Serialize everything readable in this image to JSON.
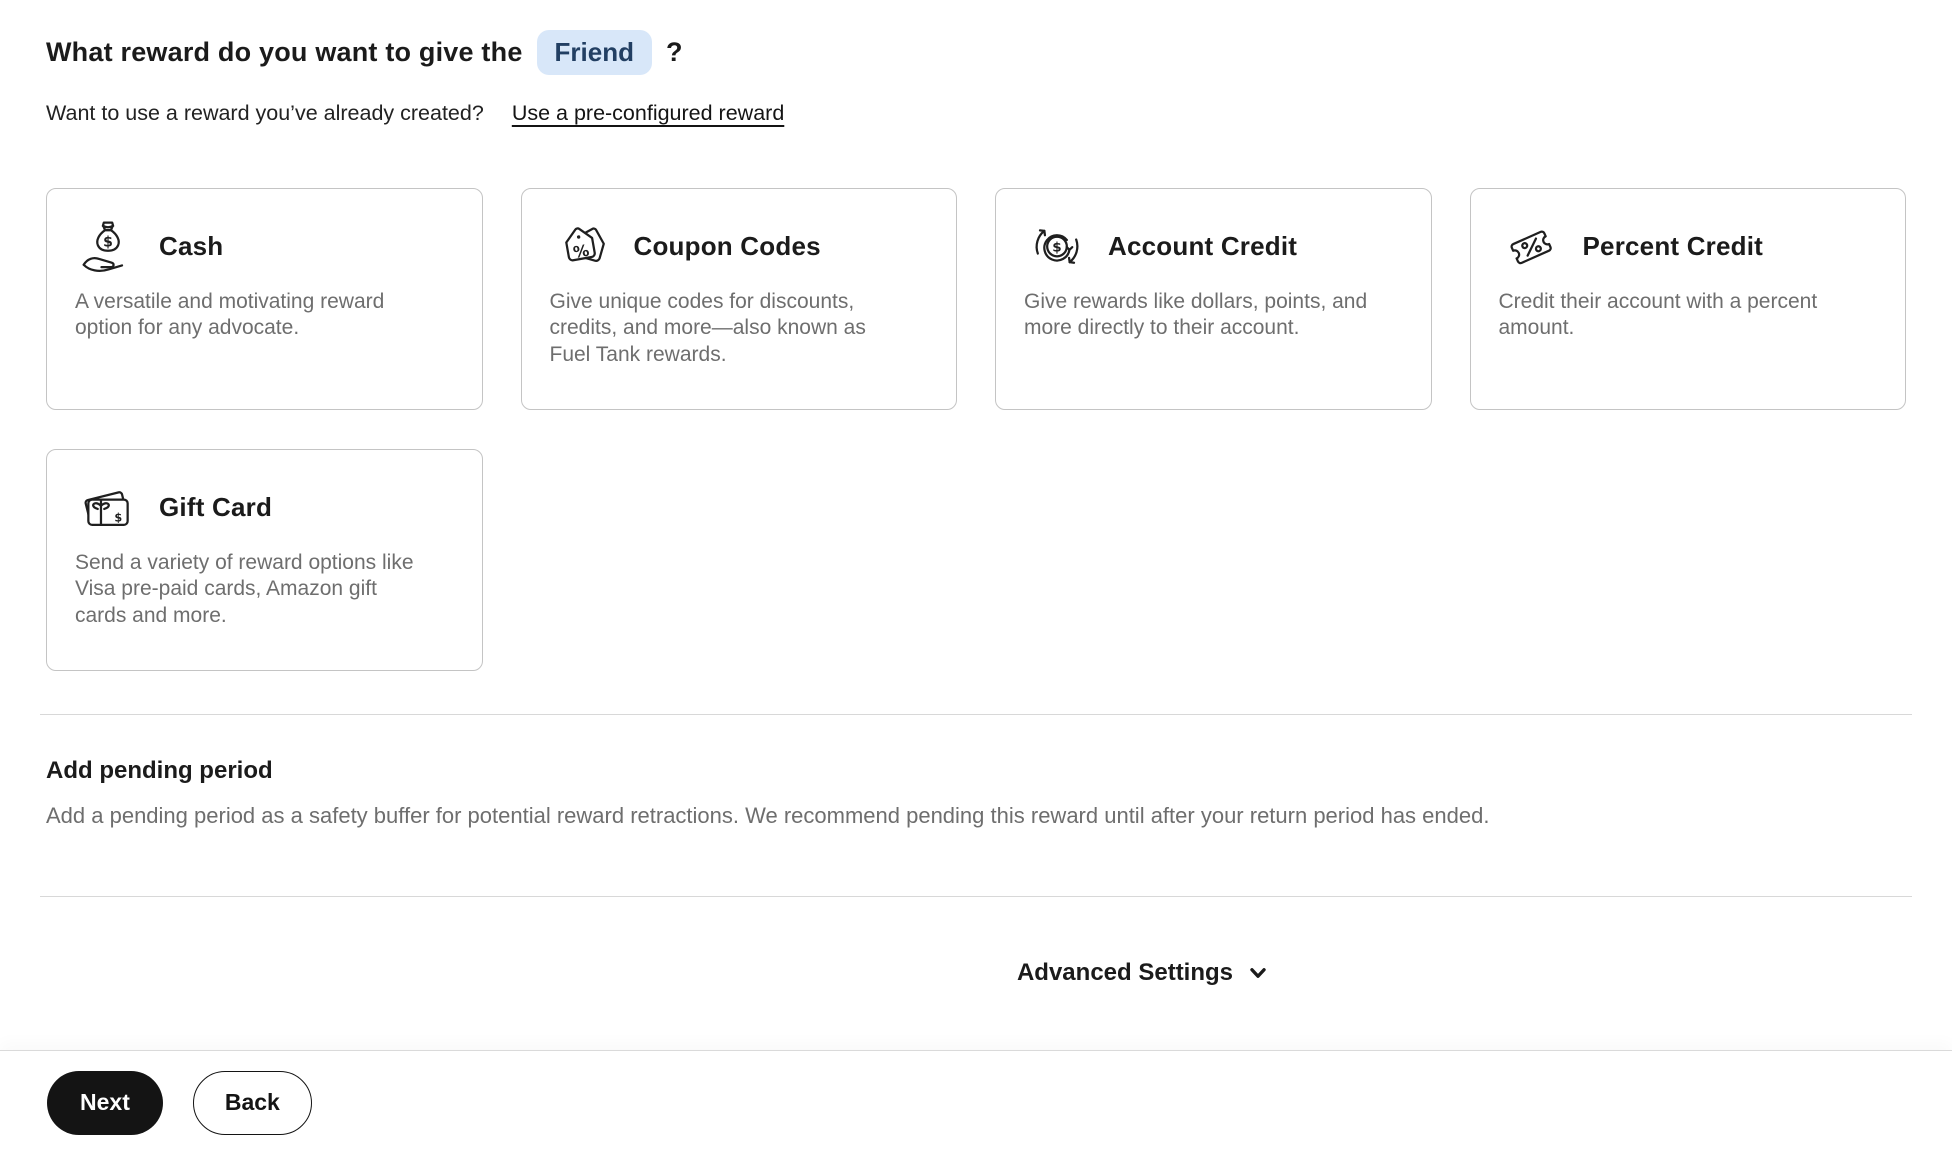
{
  "header": {
    "title_prefix": "What reward do you want to give the",
    "title_highlight": "Friend",
    "title_suffix": "?",
    "subtitle_question": "Want to use a reward you’ve already created?",
    "subtitle_link": "Use a pre-configured reward"
  },
  "reward_options": [
    {
      "id": "cash",
      "title": "Cash",
      "description": "A versatile and motivating reward option for any advocate.",
      "icon": "cash-bag-in-hand-icon"
    },
    {
      "id": "coupon-codes",
      "title": "Coupon Codes",
      "description": "Give unique codes for discounts, credits, and more—also known as Fuel Tank rewards.",
      "icon": "percent-tags-icon"
    },
    {
      "id": "account-credit",
      "title": "Account Credit",
      "description": "Give rewards like dollars, points, and more directly to their account.",
      "icon": "dollar-circular-arrows-icon"
    },
    {
      "id": "percent-credit",
      "title": "Percent Credit",
      "description": "Credit their account with a percent amount.",
      "icon": "percent-ticket-icon"
    },
    {
      "id": "gift-card",
      "title": "Gift Card",
      "description": "Send a variety of reward options like Visa pre-paid cards, Amazon gift cards and more.",
      "icon": "gift-cards-icon"
    }
  ],
  "pending_period": {
    "heading": "Add pending period",
    "description": "Add a pending period as a safety buffer for potential reward retractions. We recommend pending this reward until after your return period has ended."
  },
  "advanced_settings": {
    "label": "Advanced Settings",
    "icon": "chevron-down-icon"
  },
  "footer": {
    "next_label": "Next",
    "back_label": "Back"
  },
  "colors": {
    "highlight_bg": "#d8e7f9",
    "highlight_text": "#223f63",
    "button_dark": "#141414",
    "card_border": "#c4c4c4",
    "muted_text": "#6e6e6e"
  }
}
